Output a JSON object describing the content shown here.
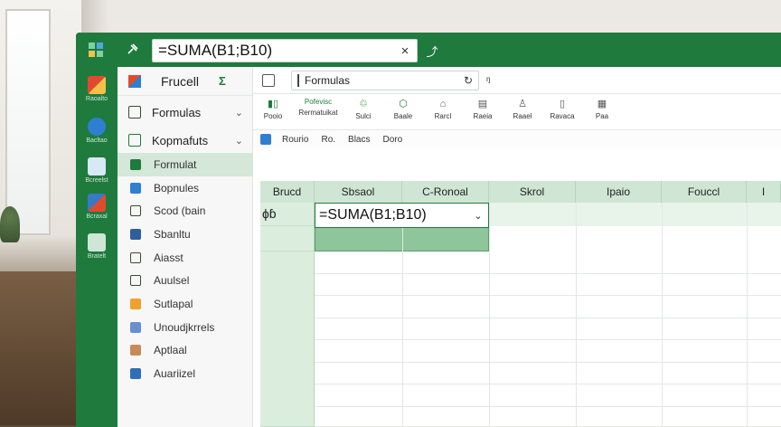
{
  "titlebar": {
    "formula": "=SUMA(B1;B10)",
    "close_glyph": "×",
    "icons": [
      "app-grid-icon",
      "pin-icon",
      "run-icon"
    ],
    "run_glyph": "⤴"
  },
  "rail": {
    "items": [
      {
        "label": "Raoalto",
        "color": "#e24a2e"
      },
      {
        "label": "Bacltao",
        "color": "#2f7fd0"
      },
      {
        "label": "Bcreelst",
        "color": "#d7e8f7"
      },
      {
        "label": "Bcraxal",
        "color": "#3a78c8"
      },
      {
        "label": "Bratelt",
        "color": "#cfe6d6"
      }
    ]
  },
  "leftpane": {
    "app_name": "Frucell",
    "app_glyph": "Σ",
    "rows": [
      {
        "label": "Formulas"
      },
      {
        "label": "Kopmafuts"
      }
    ],
    "nav": [
      {
        "label": "Formulat",
        "color": "#1f7a3e"
      },
      {
        "label": "Bopnules",
        "color": "#2f7fd0"
      },
      {
        "label": "Scod (bain",
        "color": "#3a4a3f"
      },
      {
        "label": "Sbanltu",
        "color": "#2f5f9a"
      },
      {
        "label": "Aiasst",
        "color": "#3a4a3f"
      },
      {
        "label": "Auulsel",
        "color": "#3a4a3f"
      },
      {
        "label": "Sutlapal",
        "color": "#f0a030"
      },
      {
        "label": "Unoudjkrrels",
        "color": "#6a8fd0"
      },
      {
        "label": "Aptlaal",
        "color": "#c98a5a"
      },
      {
        "label": "Auariizel",
        "color": "#2f6fb8"
      }
    ]
  },
  "main": {
    "tab_label": "Formulas",
    "tab_refresh": "↻",
    "tab_more": "ᵑ",
    "ribbon": [
      {
        "top": "Pofevisc",
        "label": "Pooio"
      },
      {
        "top": "",
        "label": "Rermatuikat"
      },
      {
        "top": "",
        "label": "Sulci"
      },
      {
        "top": "",
        "label": "Baale"
      },
      {
        "top": "",
        "label": "Rarcl"
      },
      {
        "top": "",
        "label": "Raeia"
      },
      {
        "top": "",
        "label": "Raael"
      },
      {
        "top": "",
        "label": "Ravaca"
      },
      {
        "top": "",
        "label": "Paa"
      }
    ],
    "subbar": [
      "Rourio",
      "Ro.",
      "Blacs",
      "Doro"
    ]
  },
  "grid": {
    "headers": [
      "Brucd",
      "Sbsaol",
      "C-Ronoal",
      "Skrol",
      "Ipaio",
      "Fouccl",
      "I"
    ],
    "name_cell": "ɸɓ",
    "active_formula": "=SUMA(B1;B10)",
    "dropdown_glyph": "⌄"
  },
  "colors": {
    "brand": "#1f7a3e",
    "header_fill": "#cfe6d5",
    "selection_fill": "#8fc59b"
  }
}
